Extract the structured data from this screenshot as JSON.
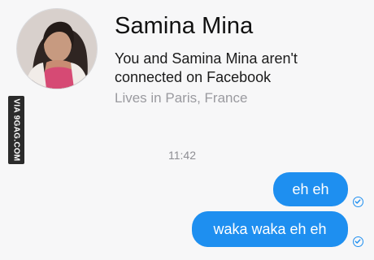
{
  "profile": {
    "name": "Samina Mina",
    "connection_note": "You and Samina Mina aren't connected on Facebook",
    "location": "Lives in Paris, France"
  },
  "watermark": "VIA 9GAG.COM",
  "conversation": {
    "timestamp": "11:42",
    "messages": [
      {
        "text": "eh eh",
        "sender": "self",
        "status_icon": "check-circle-icon"
      },
      {
        "text": "waka waka eh eh",
        "sender": "self",
        "status_icon": "check-circle-icon"
      }
    ]
  },
  "colors": {
    "bubble": "#1e8ff0",
    "background": "#f7f7f8"
  }
}
